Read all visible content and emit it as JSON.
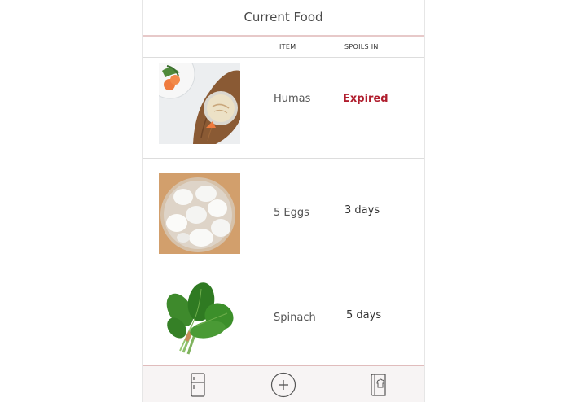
{
  "header": {
    "title": "Current Food"
  },
  "columns": {
    "item": "ITEM",
    "spoils_in": "SPOILS IN"
  },
  "foods": [
    {
      "name": "Humas",
      "spoils_in": "Expired",
      "status": "expired",
      "image": "hummus-photo"
    },
    {
      "name": "5 Eggs",
      "spoils_in": "3 days",
      "status": "fresh",
      "image": "eggs-photo"
    },
    {
      "name": "Spinach",
      "spoils_in": "5 days",
      "status": "fresh",
      "image": "spinach-photo"
    }
  ],
  "tabbar": {
    "items": [
      {
        "icon": "fridge-icon"
      },
      {
        "icon": "add-circle-icon"
      },
      {
        "icon": "recipe-book-icon"
      }
    ]
  },
  "colors": {
    "expired": "#b01e2e",
    "header_border": "#e7c9c9",
    "tabbar_bg": "#f7f4f4"
  }
}
